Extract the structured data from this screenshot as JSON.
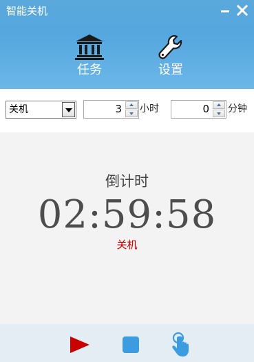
{
  "window": {
    "title": "智能关机"
  },
  "nav": {
    "tasks_label": "任务",
    "settings_label": "设置"
  },
  "controls": {
    "action_selected": "关机",
    "hours_value": "3",
    "hours_unit": "小时",
    "minutes_value": "0",
    "minutes_unit": "分钟"
  },
  "countdown": {
    "title": "倒计时",
    "time": "02:59:58",
    "action": "关机"
  },
  "colors": {
    "header": "#55a7df",
    "play": "#c80000",
    "stop": "#3d9be0",
    "hand": "#3d9be0",
    "action_text": "#d00000"
  },
  "icons": {
    "tasks": "bank-icon",
    "settings": "wrench-icon",
    "play": "play-icon",
    "stop": "stop-icon",
    "hand": "tap-hand-icon"
  }
}
